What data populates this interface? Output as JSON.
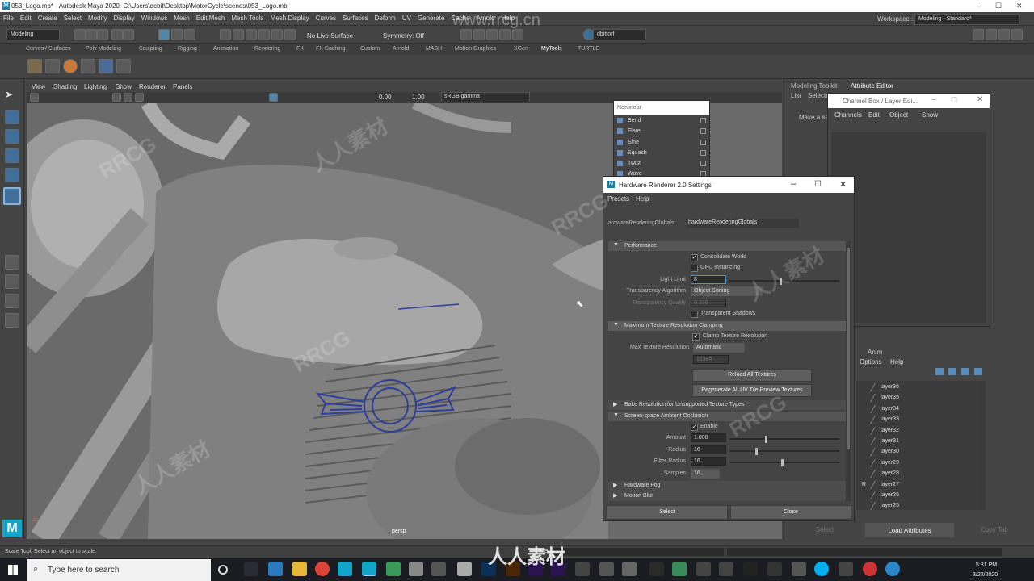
{
  "window": {
    "title": "053_Logo.mb* - Autodesk Maya 2020: C:\\Users\\dcbit\\Desktop\\MotorCycle\\scenes\\053_Logo.mb",
    "min": "–",
    "max": "☐",
    "close": "✕"
  },
  "menu": [
    "File",
    "Edit",
    "Create",
    "Select",
    "Modify",
    "Display",
    "Windows",
    "Mesh",
    "Edit Mesh",
    "Mesh Tools",
    "Mesh Display",
    "Curves",
    "Surfaces",
    "Deform",
    "UV",
    "Generate",
    "Cache",
    "Arnold",
    "Help"
  ],
  "workspace": {
    "label": "Workspace :",
    "value": "Modeling - Standard*"
  },
  "status": {
    "mode": "Modeling",
    "live": "No Live Surface",
    "symmetry": "Symmetry: Off",
    "user": "dbittorf"
  },
  "shelf_tabs": [
    "Curves / Surfaces",
    "Poly Modeling",
    "Sculpting",
    "Rigging",
    "Animation",
    "Rendering",
    "FX",
    "FX Caching",
    "Custom",
    "Arnold",
    "MASH",
    "Motion Graphics",
    "XGen",
    "MyTools",
    "TURTLE"
  ],
  "viewport_menu": [
    "View",
    "Shading",
    "Lighting",
    "Show",
    "Renderer",
    "Panels"
  ],
  "viewport_toolbar": {
    "val1": "0.00",
    "val2": "1.00",
    "colorspace": "sRGB gamma"
  },
  "viewport_label": "persp",
  "nonlinear": {
    "title": "Nonlinear",
    "items": [
      "Bend",
      "Flare",
      "Sine",
      "Squash",
      "Twist",
      "Wave"
    ]
  },
  "right_panel": {
    "tabs": [
      "Modeling Toolkit",
      "Attribute Editor"
    ],
    "menu": [
      "List",
      "Selected"
    ],
    "make_sel": "Make a sel",
    "bottom_buttons": [
      "Select",
      "Load Attributes",
      "Copy Tab"
    ]
  },
  "channel_box": {
    "title": "Channel Box / Layer Edi...",
    "menu": [
      "Channels",
      "Edit",
      "Object",
      "Show"
    ]
  },
  "layer_editor": {
    "tabs": [
      "Anim"
    ],
    "menu": [
      "Options",
      "Help"
    ],
    "layers": [
      "layer36",
      "layer35",
      "layer34",
      "layer33",
      "layer32",
      "layer31",
      "layer30",
      "layer29",
      "layer28",
      "layer27",
      "layer26",
      "layer25"
    ],
    "r_mark": "R"
  },
  "hw": {
    "title": "Hardware Renderer 2.0 Settings",
    "menu": [
      "Presets",
      "Help"
    ],
    "globals_label": "ardwareRenderingGlobals:",
    "globals_value": "hardwareRenderingGlobals",
    "sections": {
      "performance": "Performance",
      "max_tex": "Maximum Texture Resolution Clamping",
      "bake": "Bake Resolution for Unsupported Texture Types",
      "ssao": "Screen-space Ambient Occlusion",
      "fog": "Hardware Fog",
      "motion": "Motion Blur"
    },
    "consolidate": "Consolidate World",
    "gpu": "GPU Instancing",
    "light_limit_label": "Light Limit",
    "light_limit": "8",
    "transp_algo_label": "Transparency Algorithm",
    "transp_algo": "Object Sorting",
    "transp_quality_label": "Transparency Quality",
    "transp_quality": "0.330",
    "transp_shadows": "Transparent Shadows",
    "clamp": "Clamp Texture Resolution",
    "max_tex_label": "Max Texture Resolution",
    "max_tex": "Automatic",
    "max_tex_val": "16384",
    "reload": "Reload All Textures",
    "regen": "Regenerate All UV Tile Preview Textures",
    "enable": "Enable",
    "amount_label": "Amount",
    "amount": "1.000",
    "radius_label": "Radius",
    "radius": "16",
    "filter_label": "Filter Radius",
    "filter": "16",
    "samples_label": "Samples",
    "samples": "16",
    "select": "Select",
    "close": "Close"
  },
  "helpline": "Scale Tool: Select an object to scale.",
  "mel": "MEL",
  "taskbar": {
    "search": "Type here to search",
    "time": "5:31 PM",
    "date": "3/22/2020"
  },
  "watermarks": [
    "RRCG",
    "人人素材",
    "www.rrcg.cn"
  ],
  "colors": {
    "accent": "#5285a6",
    "bg": "#444444",
    "viewport": "#6d6d6d"
  }
}
